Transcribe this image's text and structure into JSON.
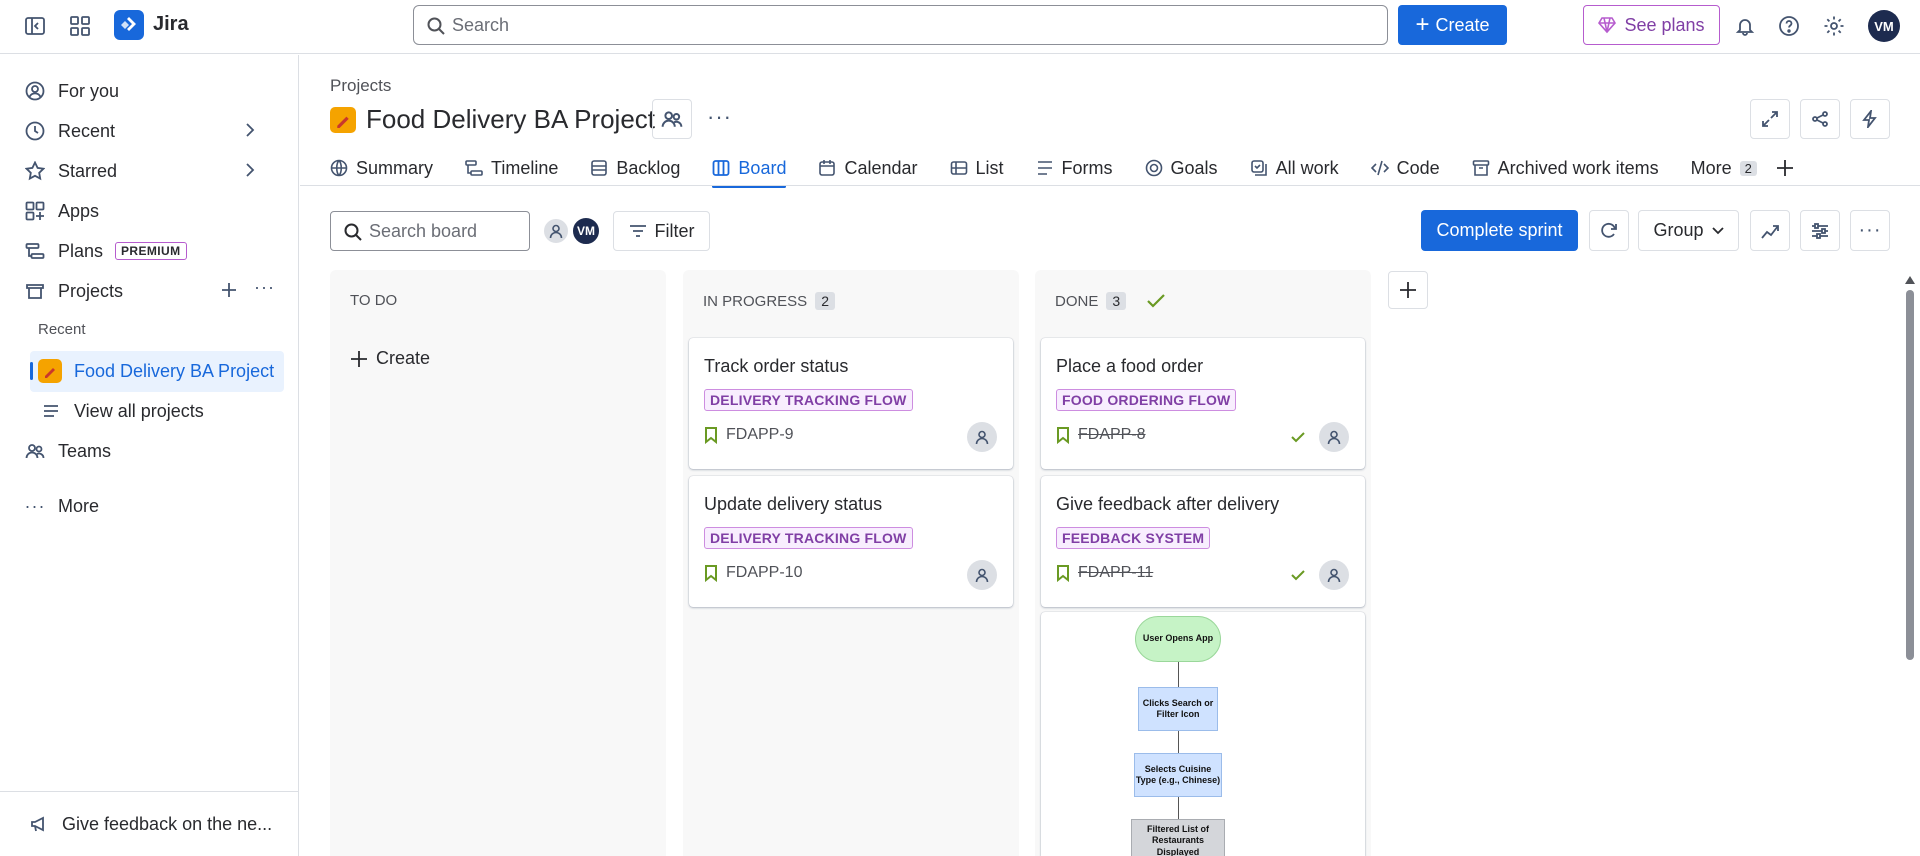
{
  "topbar": {
    "app_name": "Jira",
    "search_placeholder": "Search",
    "create_label": "Create",
    "see_plans_label": "See plans",
    "user_initials": "VM"
  },
  "sidebar": {
    "items": [
      {
        "label": "For you",
        "icon": "person-circle-icon"
      },
      {
        "label": "Recent",
        "icon": "clock-icon"
      },
      {
        "label": "Starred",
        "icon": "star-icon"
      },
      {
        "label": "Apps",
        "icon": "apps-icon"
      },
      {
        "label": "Plans",
        "icon": "plans-icon",
        "badge": "PREMIUM"
      },
      {
        "label": "Projects",
        "icon": "projects-icon"
      }
    ],
    "recent_heading": "Recent",
    "active_project": "Food Delivery BA Project",
    "view_all": "View all projects",
    "teams": "Teams",
    "more": "More",
    "feedback": "Give feedback on the ne..."
  },
  "header": {
    "breadcrumb": "Projects",
    "project_title": "Food Delivery BA Project"
  },
  "tabs": [
    {
      "label": "Summary"
    },
    {
      "label": "Timeline"
    },
    {
      "label": "Backlog"
    },
    {
      "label": "Board",
      "active": true
    },
    {
      "label": "Calendar"
    },
    {
      "label": "List"
    },
    {
      "label": "Forms"
    },
    {
      "label": "Goals"
    },
    {
      "label": "All work"
    },
    {
      "label": "Code"
    },
    {
      "label": "Archived work items"
    },
    {
      "label": "More",
      "count": "2"
    }
  ],
  "toolbar": {
    "search_placeholder": "Search board",
    "user_initials": "VM",
    "filter_label": "Filter",
    "complete_label": "Complete sprint",
    "group_label": "Group"
  },
  "columns": {
    "todo": {
      "title": "TO DO",
      "create_label": "Create"
    },
    "inprogress": {
      "title": "IN PROGRESS",
      "count": "2",
      "cards": [
        {
          "title": "Track order status",
          "tag": "DELIVERY TRACKING FLOW",
          "key": "FDAPP-9"
        },
        {
          "title": "Update delivery status",
          "tag": "DELIVERY TRACKING FLOW",
          "key": "FDAPP-10"
        }
      ]
    },
    "done": {
      "title": "DONE",
      "count": "3",
      "cards": [
        {
          "title": "Place a food order",
          "tag": "FOOD ORDERING FLOW",
          "key": "FDAPP-8"
        },
        {
          "title": "Give feedback after delivery",
          "tag": "FEEDBACK SYSTEM",
          "key": "FDAPP-11"
        }
      ],
      "flowchart": {
        "node1": "User Opens App",
        "node2": "Clicks Search or Filter Icon",
        "node3": "Selects Cuisine Type (e.g., Chinese)",
        "node4": "Filtered List of Restaurants Displayed"
      }
    }
  },
  "colors": {
    "accent": "#1868db",
    "tag_bg": "#f8eefe",
    "tag_text": "#803fa5",
    "done_check": "#6a9a23"
  }
}
